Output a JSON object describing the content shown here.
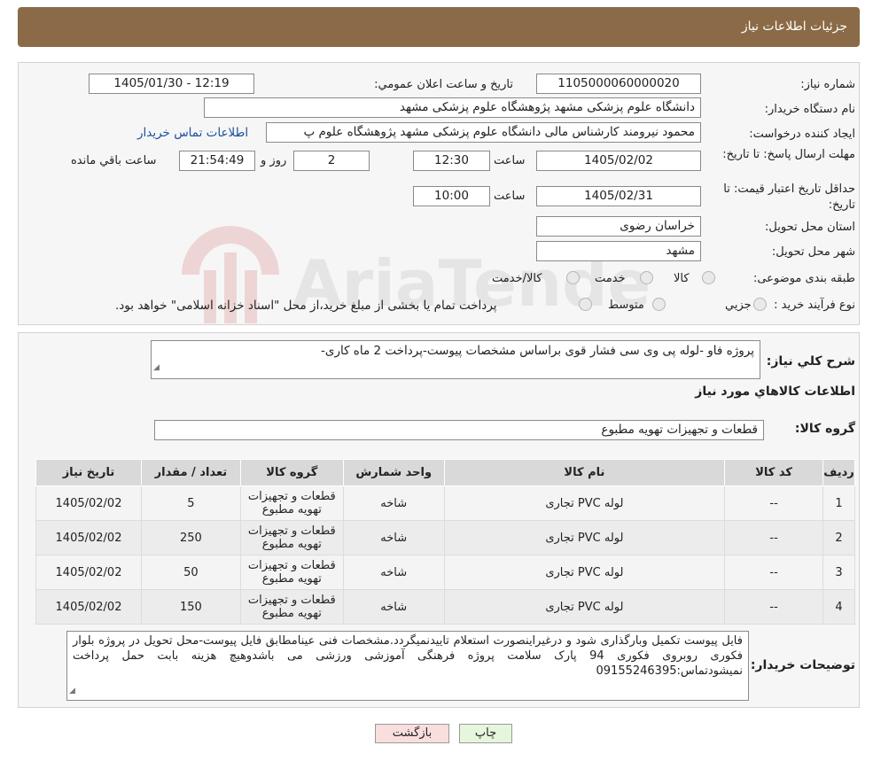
{
  "header": {
    "title": "جزئیات اطلاعات نیاز"
  },
  "form": {
    "need_number_label": "شماره نیاز:",
    "need_number": "1105000060000020",
    "announce_label": "تاریخ و ساعت اعلان عمومي:",
    "announce_value": "1405/01/30 - 12:19",
    "buyer_org_label": "نام دستگاه خريدار:",
    "buyer_org": "دانشگاه علوم پزشکی مشهد   پژوهشگاه علوم پزشکی مشهد",
    "creator_label": "ايجاد کننده درخواست:",
    "creator": "محمود نیرومند کارشناس مالی دانشگاه علوم پزشکی مشهد   پژوهشگاه علوم پ",
    "contact_link": "اطلاعات تماس خريدار",
    "deadline_label": "مهلت ارسال پاسخ: تا تاريخ:",
    "deadline_date": "1405/02/02",
    "time_label": "ساعت",
    "deadline_time": "12:30",
    "days_value": "2",
    "days_label": "روز و",
    "remaining_time": "21:54:49",
    "remaining_label": "ساعت باقي مانده",
    "validity_label": "حداقل تاريخ اعتبار قيمت: تا تاريخ:",
    "validity_date": "1405/02/31",
    "validity_time": "10:00",
    "province_label": "استان محل تحويل:",
    "province": "خراسان رضوی",
    "city_label": "شهر محل تحويل:",
    "city": "مشهد",
    "category_label": "طبقه بندی موضوعی:",
    "category_options": [
      "کالا",
      "خدمت",
      "کالا/خدمت"
    ],
    "process_label": "نوع فرآيند خريد :",
    "process_options": [
      "جزيي",
      "متوسط"
    ],
    "process_note": "پرداخت تمام يا بخشی از مبلغ خريد،از محل \"اسناد خزانه اسلامی\" خواهد بود."
  },
  "description": {
    "label": "شرح کلي نياز:",
    "text": "پروژه فاو -لوله پی وی سی فشار قوی براساس مشخصات پیوست-پرداخت 2 ماه کاری-"
  },
  "goods_info_title": "اطلاعات کالاهاي مورد نياز",
  "goods_group": {
    "label": "گروه کالا:",
    "value": "قطعات و تجهیزات تهویه مطبوع"
  },
  "table": {
    "headers": [
      "رديف",
      "کد کالا",
      "نام کالا",
      "واحد شمارش",
      "گروه کالا",
      "تعداد / مقدار",
      "تاريخ نياز"
    ],
    "rows": [
      [
        "1",
        "--",
        "لوله PVC تجاری",
        "شاخه",
        "قطعات و تجهیزات تهویه مطبوع",
        "5",
        "1405/02/02"
      ],
      [
        "2",
        "--",
        "لوله PVC تجاری",
        "شاخه",
        "قطعات و تجهیزات تهویه مطبوع",
        "250",
        "1405/02/02"
      ],
      [
        "3",
        "--",
        "لوله PVC تجاری",
        "شاخه",
        "قطعات و تجهیزات تهویه مطبوع",
        "50",
        "1405/02/02"
      ],
      [
        "4",
        "--",
        "لوله PVC تجاری",
        "شاخه",
        "قطعات و تجهیزات تهویه مطبوع",
        "150",
        "1405/02/02"
      ]
    ]
  },
  "buyer_notes": {
    "label": "توضيحات خريدار:",
    "text": "فایل پیوست تکمیل وبارگذاری شود و درغیراینصورت استعلام تاییدنمیگردد.مشخصات فنی عینامطابق فایل پیوست-محل تحویل در پروژه بلوار فکوری روبروی فکوری 94 پارک سلامت پروژه فرهنگی آموزشی ورزشی می باشدوهیچ هزینه بابت حمل پرداخت نمیشودتماس:09155246395"
  },
  "buttons": {
    "print": "چاپ",
    "back": "بازگشت"
  },
  "watermark_text": "AriaTender.neT",
  "colors": {
    "header_bg": "#8b6b47",
    "link": "#1a4fa0",
    "back_btn": "#f9dede",
    "print_btn": "#e6f6dc"
  }
}
